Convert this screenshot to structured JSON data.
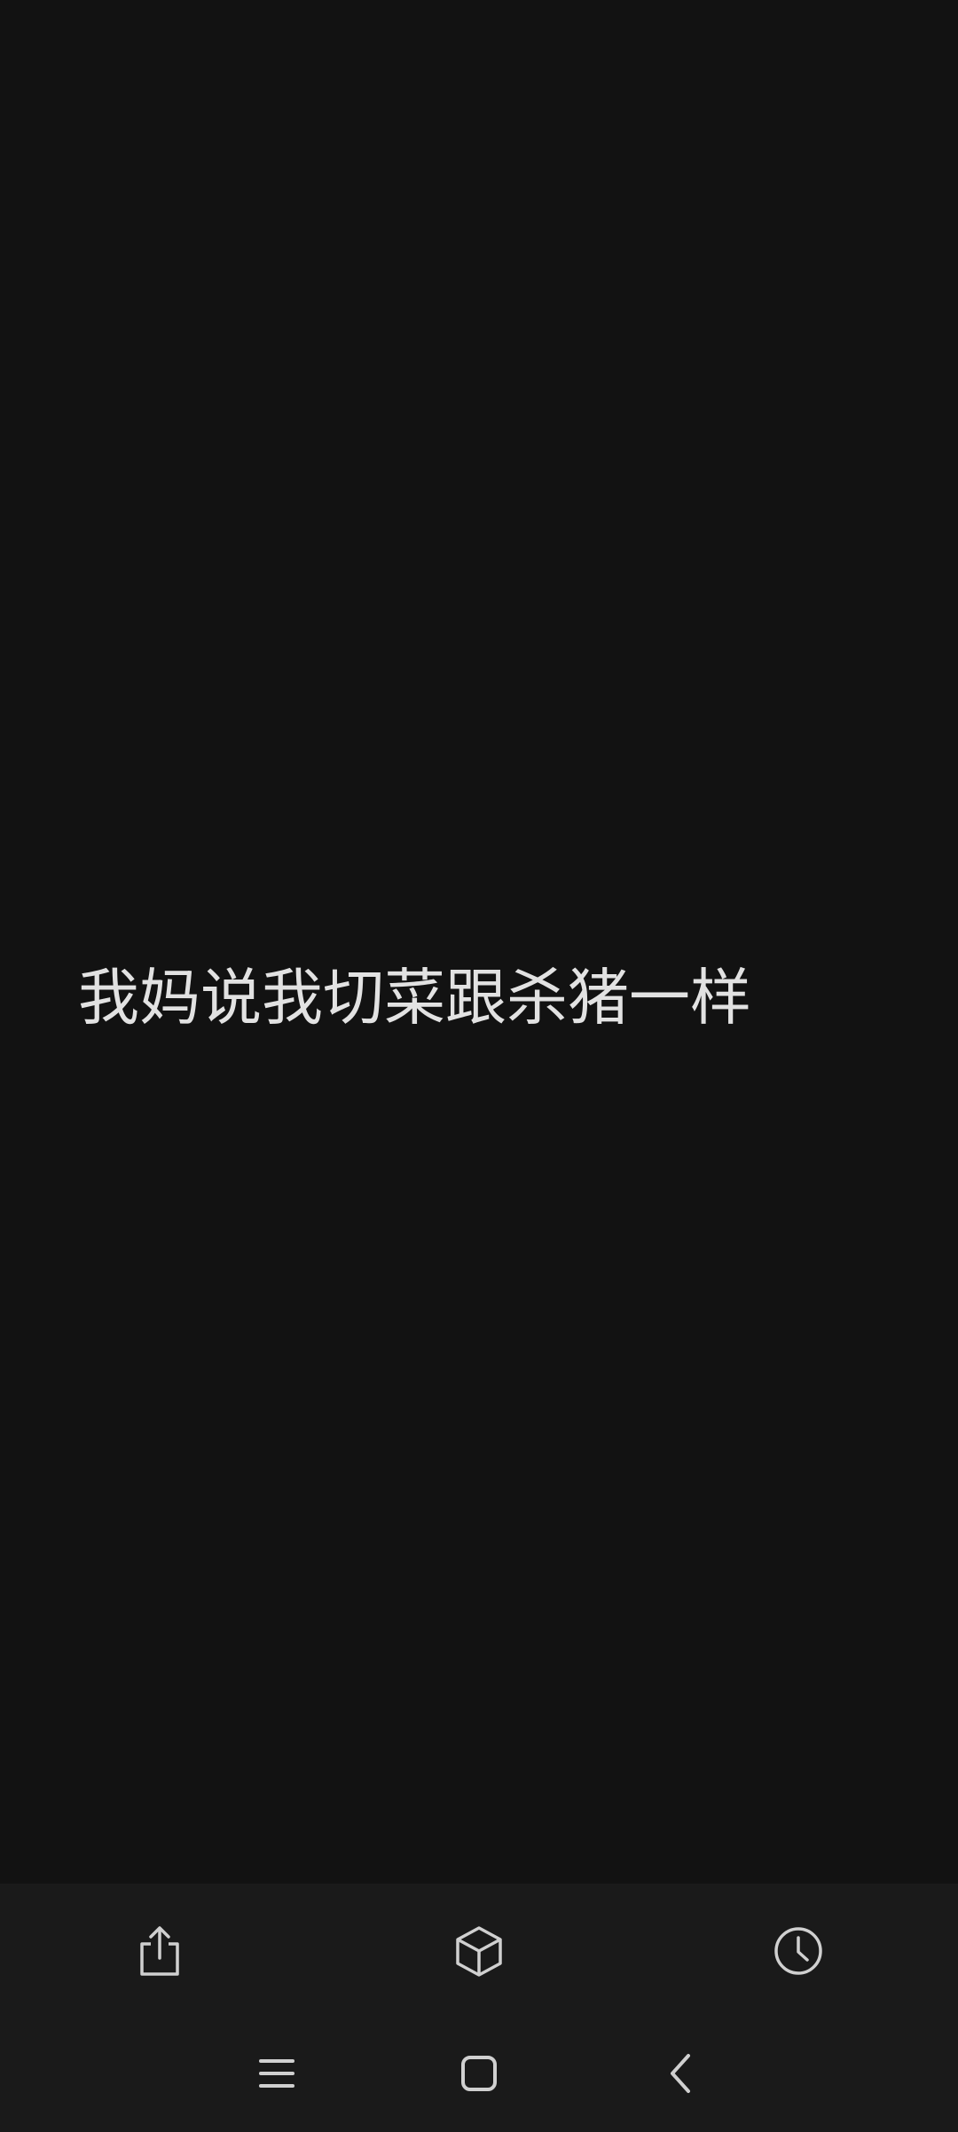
{
  "note": {
    "text": "我妈说我切菜跟杀猪一样"
  },
  "toolbar": {
    "items": [
      {
        "name": "share-button",
        "icon": "share-icon"
      },
      {
        "name": "3d-box-button",
        "icon": "cube-icon"
      },
      {
        "name": "history-button",
        "icon": "clock-icon"
      }
    ]
  },
  "navigation_bar": {
    "items": [
      {
        "name": "recent-apps-button",
        "icon": "recent-apps-icon"
      },
      {
        "name": "home-button",
        "icon": "home-icon"
      },
      {
        "name": "back-button",
        "icon": "back-icon"
      }
    ]
  },
  "colors": {
    "background": "#121212",
    "bar_background": "#1a1a1a",
    "text": "#e2e2e2",
    "icon": "#d0d0d0"
  }
}
